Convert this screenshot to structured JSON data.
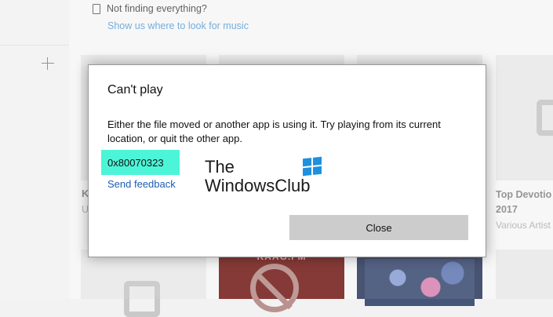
{
  "background": {
    "not_finding_text": "Not finding everything?",
    "show_link": "Show us where to look for music",
    "tile_k_title": "K",
    "tile_u_subtitle": "U",
    "radio_tile_label": "KAAG.FM",
    "tile_right_title": "Top Devotio 2017",
    "tile_right_artist": "Various Artist"
  },
  "dialog": {
    "title": "Can't play",
    "message": "Either the file moved or another app is using it. Try playing from its current location, or quit the other app.",
    "error_code": "0x80070323",
    "feedback_link": "Send feedback",
    "close_label": "Close"
  },
  "watermark": {
    "line1": "The",
    "line2": "WindowsClub"
  },
  "colors": {
    "error_highlight": "#4cf5d8",
    "link": "#1a5fb4",
    "close_button": "#cccccc"
  }
}
